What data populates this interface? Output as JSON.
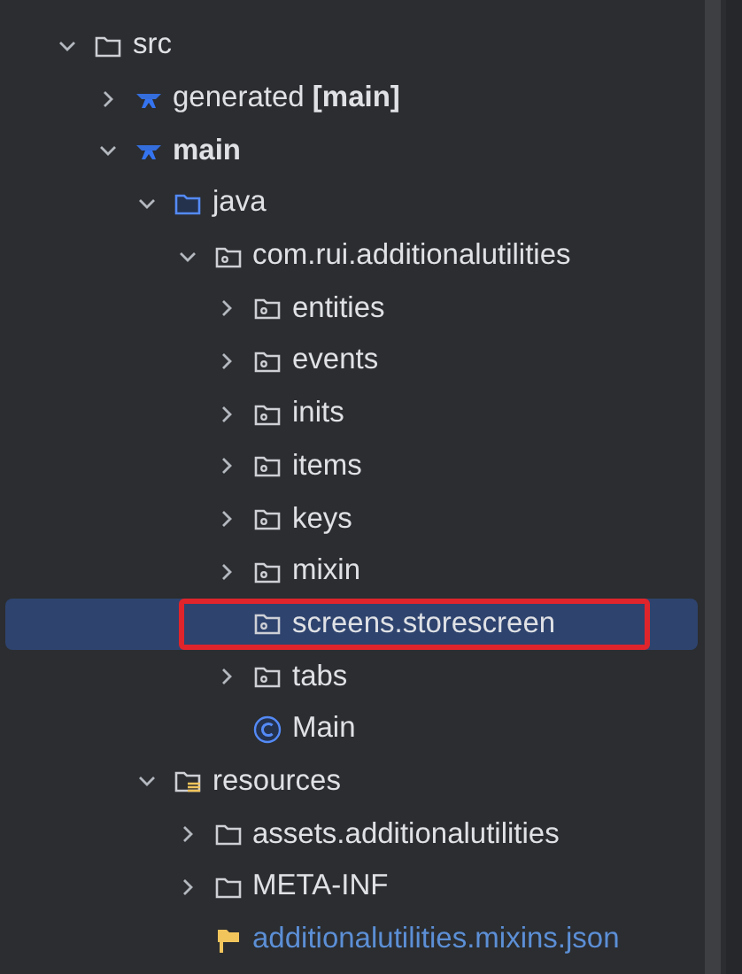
{
  "project_tree": [
    {
      "label": "src",
      "kind": "folder",
      "expanded": true,
      "selected": false,
      "children": [
        {
          "label": "generated **[main]**",
          "kind": "module",
          "expanded": false,
          "selected": false
        },
        {
          "label": "main",
          "kind": "module",
          "bold": true,
          "expanded": true,
          "selected": false,
          "children": [
            {
              "label": "java",
              "kind": "source-folder",
              "expanded": true,
              "selected": false,
              "children": [
                {
                  "label": "com.rui.additionalutilities",
                  "kind": "package",
                  "expanded": true,
                  "selected": false,
                  "children": [
                    {
                      "label": "entities",
                      "kind": "package",
                      "expanded": false,
                      "selected": false
                    },
                    {
                      "label": "events",
                      "kind": "package",
                      "expanded": false,
                      "selected": false
                    },
                    {
                      "label": "inits",
                      "kind": "package",
                      "expanded": false,
                      "selected": false
                    },
                    {
                      "label": "items",
                      "kind": "package",
                      "expanded": false,
                      "selected": false
                    },
                    {
                      "label": "keys",
                      "kind": "package",
                      "expanded": false,
                      "selected": false
                    },
                    {
                      "label": "mixin",
                      "kind": "package",
                      "expanded": false,
                      "selected": false
                    },
                    {
                      "label": "screens.storescreen",
                      "kind": "package",
                      "selected": true,
                      "highlighted": true
                    },
                    {
                      "label": "tabs",
                      "kind": "package",
                      "expanded": false,
                      "selected": false
                    },
                    {
                      "label": "Main",
                      "kind": "class",
                      "selected": false
                    }
                  ]
                }
              ]
            },
            {
              "label": "resources",
              "kind": "resources-folder",
              "expanded": true,
              "selected": false,
              "children": [
                {
                  "label": "assets.additionalutilities",
                  "kind": "folder",
                  "expanded": false,
                  "selected": false
                },
                {
                  "label": "META-INF",
                  "kind": "folder",
                  "expanded": false,
                  "selected": false
                },
                {
                  "label": "additionalutilities.mixins.json",
                  "kind": "json",
                  "selected": false
                }
              ]
            }
          ]
        }
      ]
    }
  ]
}
